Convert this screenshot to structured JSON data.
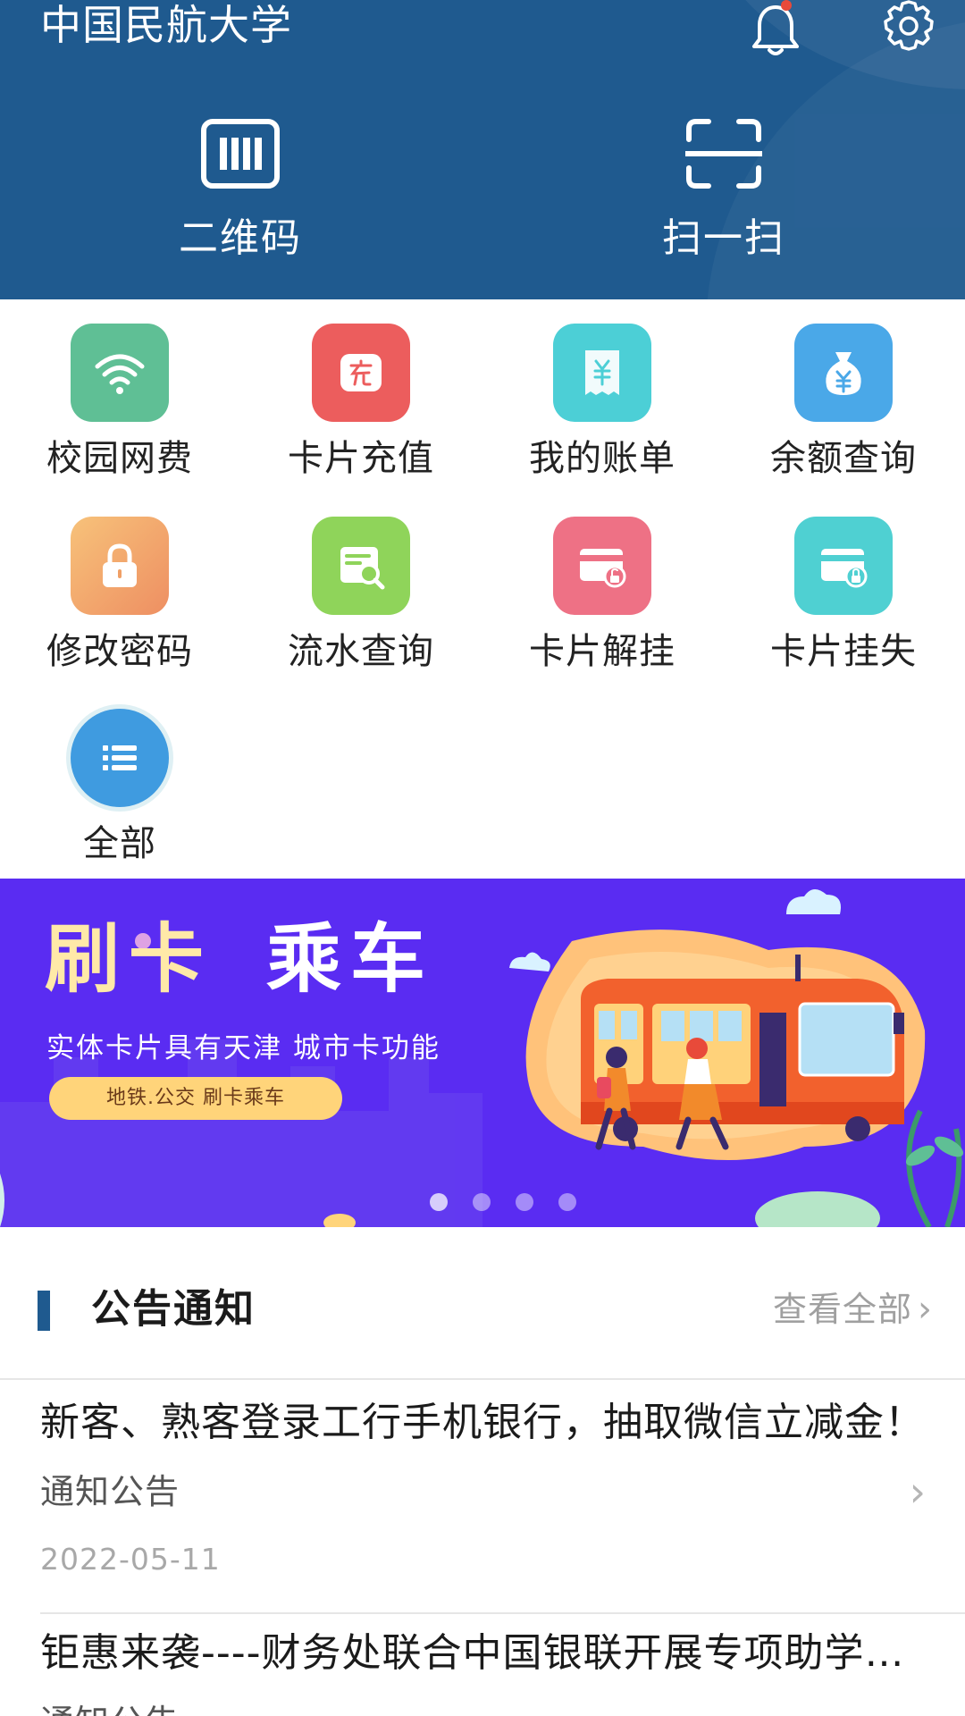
{
  "header": {
    "title": "中国民航大学",
    "icons": {
      "bell": "bell-icon",
      "settings": "gear-icon"
    },
    "actions": [
      {
        "label": "二维码",
        "icon": "barcode-icon"
      },
      {
        "label": "扫一扫",
        "icon": "scan-icon"
      }
    ],
    "colors": {
      "background": "#1f5a8f"
    }
  },
  "services": [
    {
      "label": "校园网费",
      "icon": "wifi-icon",
      "color": "#5fbf95"
    },
    {
      "label": "卡片充值",
      "icon": "recharge-icon",
      "color": "#ec5d5d"
    },
    {
      "label": "我的账单",
      "icon": "bill-icon",
      "color": "#4ccfd6"
    },
    {
      "label": "余额查询",
      "icon": "money-bag-icon",
      "color": "#4aa8e8"
    },
    {
      "label": "修改密码",
      "icon": "lock-icon",
      "color": "#f3a866"
    },
    {
      "label": "流水查询",
      "icon": "search-record-icon",
      "color": "#8fd45a"
    },
    {
      "label": "卡片解挂",
      "icon": "card-unlock-icon",
      "color": "#ee7185"
    },
    {
      "label": "卡片挂失",
      "icon": "card-lock-icon",
      "color": "#4fd0d2"
    },
    {
      "label": "全部",
      "icon": "list-icon",
      "color": "#3f9be0"
    }
  ],
  "banner": {
    "title_left": "刷卡",
    "title_right": "乘车",
    "subtitle": "实体卡片具有天津 城市卡功能",
    "pill": "地铁.公交 刷卡乘车",
    "dots": 4,
    "active_dot": 0
  },
  "notice": {
    "title": "公告通知",
    "more": "查看全部",
    "items": [
      {
        "title": "新客、熟客登录工行手机银行，抽取微信立减金！",
        "category": "通知公告",
        "date": "2022-05-11"
      },
      {
        "title": "钜惠来袭----财务处联合中国银联开展专项助学…",
        "category": "通知公告",
        "date": ""
      }
    ]
  }
}
